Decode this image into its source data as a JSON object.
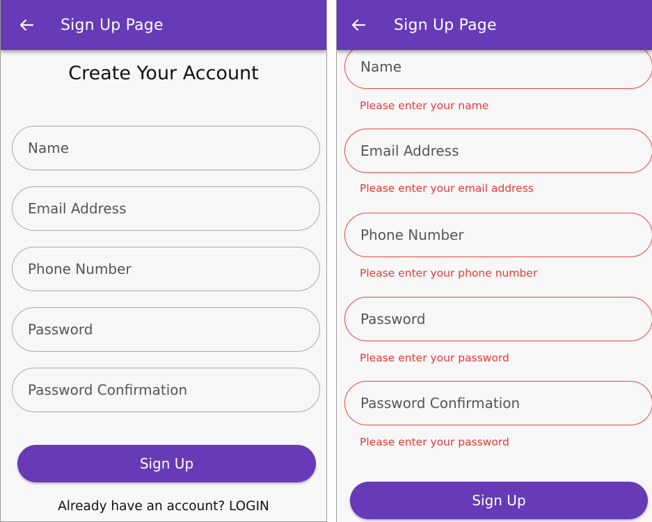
{
  "screens": [
    {
      "appbar": {
        "title": "Sign Up Page",
        "back_icon": "arrow-left-icon"
      },
      "heading": "Create Your Account",
      "fields": [
        {
          "placeholder": "Name"
        },
        {
          "placeholder": "Email Address"
        },
        {
          "placeholder": "Phone Number"
        },
        {
          "placeholder": "Password"
        },
        {
          "placeholder": "Password Confirmation"
        }
      ],
      "signup_label": "Sign Up",
      "login_prompt": "Already have an account? LOGIN"
    },
    {
      "appbar": {
        "title": "Sign Up Page",
        "back_icon": "arrow-left-icon"
      },
      "fields": [
        {
          "placeholder": "Name",
          "error": "Please enter your name"
        },
        {
          "placeholder": "Email Address",
          "error": "Please enter your email address"
        },
        {
          "placeholder": "Phone Number",
          "error": "Please enter your phone number"
        },
        {
          "placeholder": "Password",
          "error": "Please enter your password"
        },
        {
          "placeholder": "Password Confirmation",
          "error": "Please enter your password"
        }
      ],
      "signup_label": "Sign Up"
    }
  ],
  "colors": {
    "primary": "#673ab7",
    "error": "#e53935",
    "background": "#f7f7f7"
  }
}
